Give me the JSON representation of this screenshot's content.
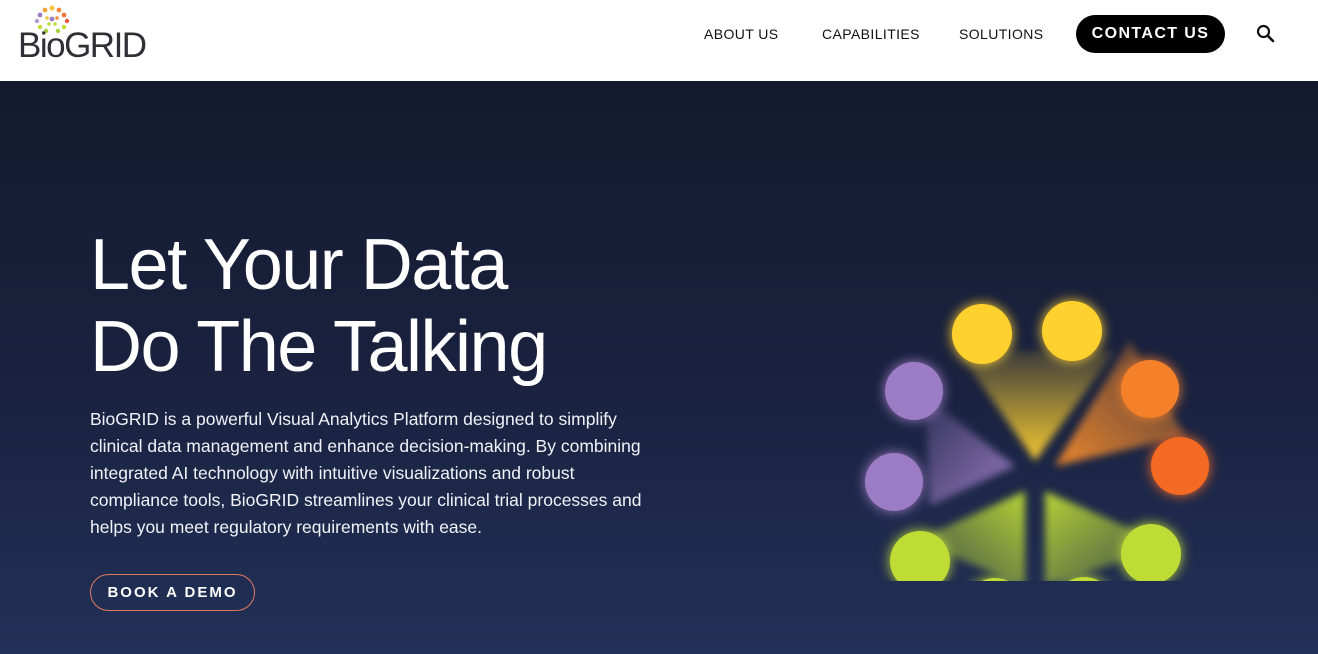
{
  "brand": {
    "name": "BioGRID"
  },
  "nav": {
    "items": [
      {
        "label": "ABOUT US"
      },
      {
        "label": "CAPABILITIES"
      },
      {
        "label": "SOLUTIONS"
      }
    ],
    "contact_label": "CONTACT US",
    "search_icon": "search-icon"
  },
  "hero": {
    "title_line1": "Let Your Data",
    "title_line2": "Do The Talking",
    "description": "BioGRID is a powerful Visual Analytics Platform designed to simplify clinical data management and enhance decision-making. By combining integrated AI technology with intuitive visualizations and robust compliance tools, BioGRID streamlines your clinical trial processes and helps you meet regulatory requirements with ease.",
    "cta_label": "BOOK A DEMO"
  },
  "colors": {
    "hero_bg": "#1a2240",
    "yellow": "#ffd12e",
    "orange": "#f58a2a",
    "purple": "#9c7cc4",
    "green": "#bfdb35",
    "cta_border": "#e07a5f"
  }
}
